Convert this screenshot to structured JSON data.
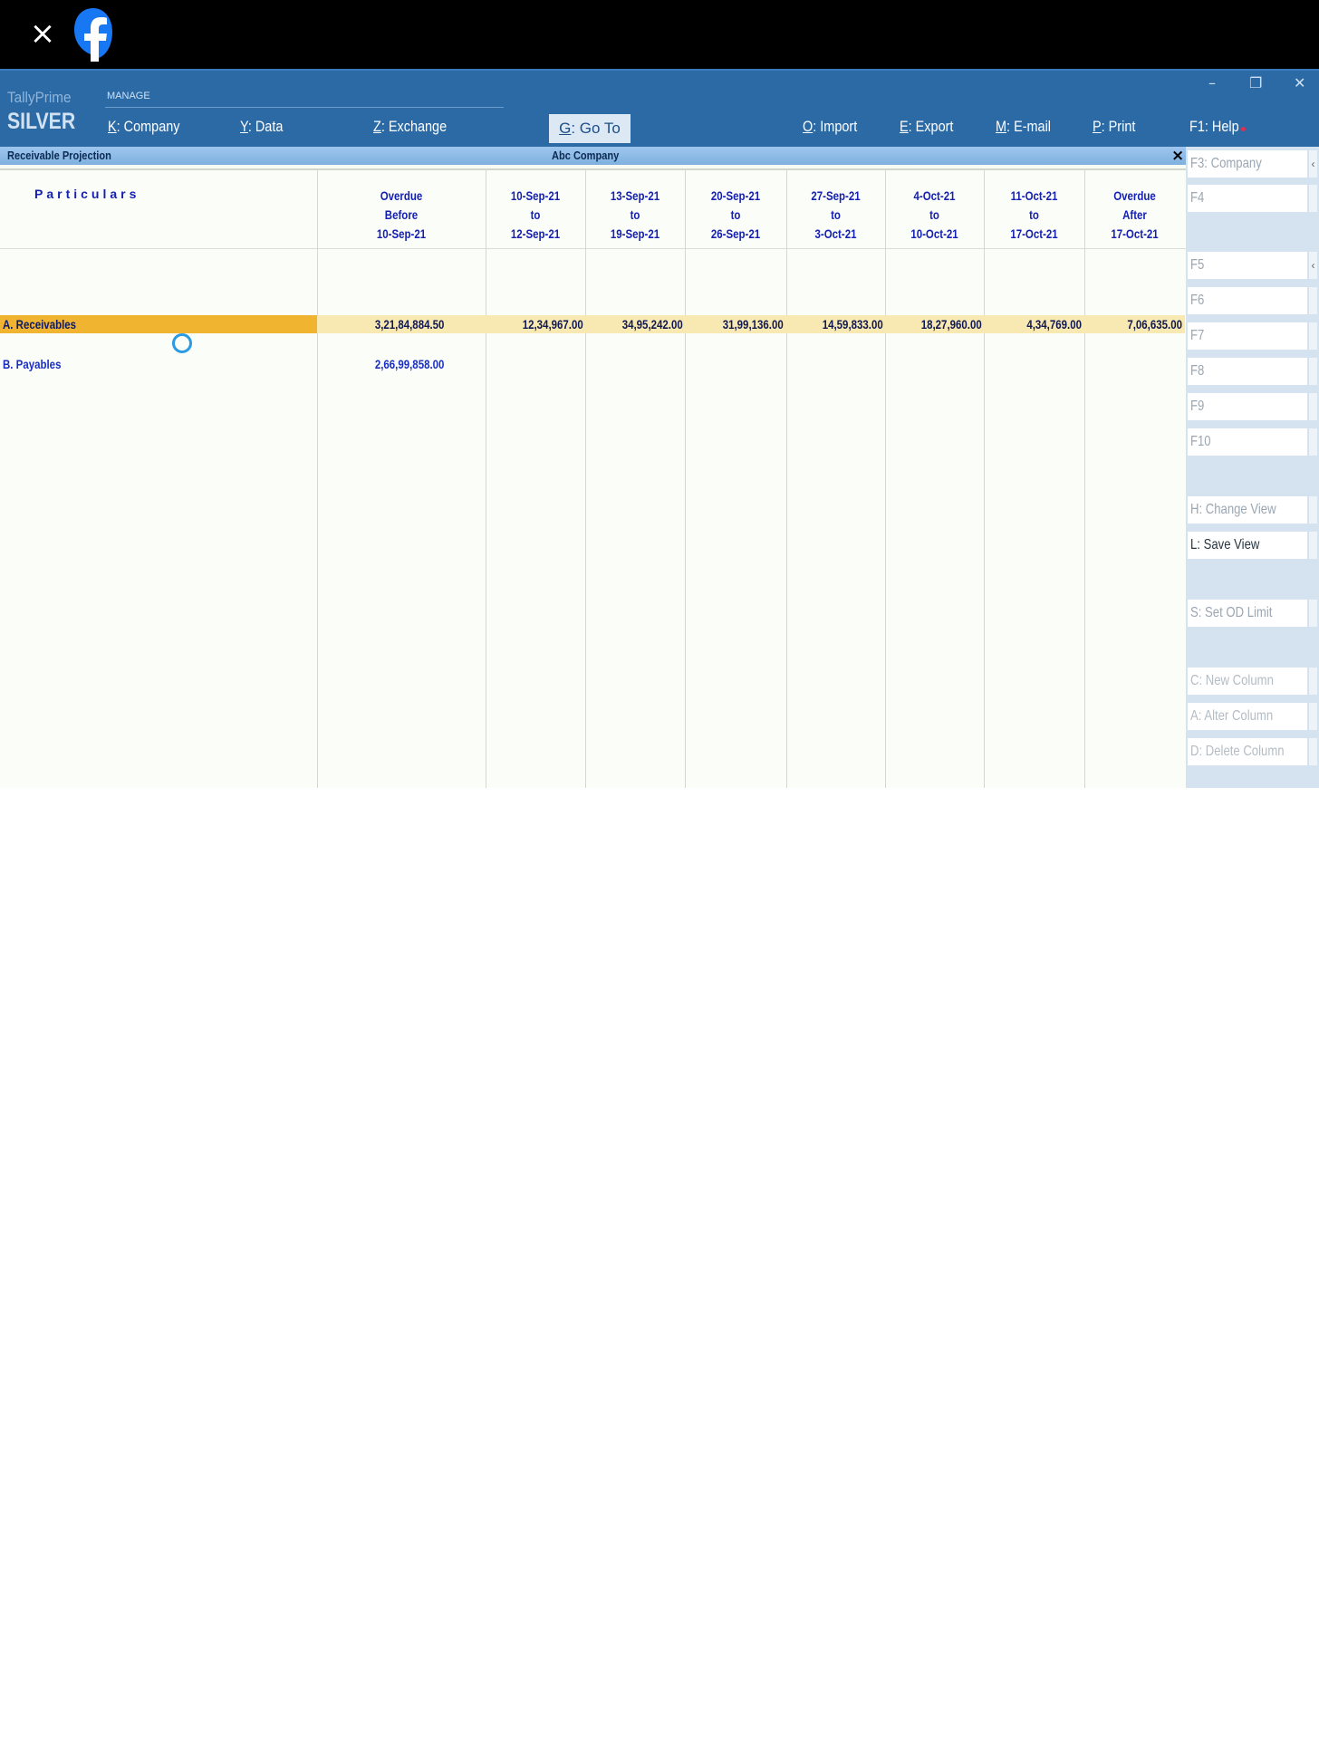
{
  "viewer": {
    "close_icon": "×"
  },
  "brand": {
    "top": "TallyPrime",
    "bottom": "SILVER"
  },
  "menu": {
    "section": "MANAGE",
    "company": {
      "key": "K",
      "label": ": Company"
    },
    "data": {
      "key": "Y",
      "label": ": Data"
    },
    "exchange": {
      "key": "Z",
      "label": ": Exchange"
    },
    "goto": {
      "key": "G",
      "label": ": Go To"
    },
    "import": {
      "key": "O",
      "label": ": Import"
    },
    "export": {
      "key": "E",
      "label": ": Export"
    },
    "email": {
      "key": "M",
      "label": ": E-mail"
    },
    "print": {
      "key": "P",
      "label": ": Print"
    },
    "help": {
      "key": "F1",
      "label": ": Help"
    }
  },
  "window_controls": {
    "minimize": "–",
    "restore": "❐",
    "close": "✕"
  },
  "report": {
    "title": "Receivable Projection",
    "company": "Abc Company",
    "close": "×",
    "particulars_header": "Particulars",
    "columns": [
      [
        "Overdue",
        "Before",
        "10-Sep-21"
      ],
      [
        "10-Sep-21",
        "to",
        "12-Sep-21"
      ],
      [
        "13-Sep-21",
        "to",
        "19-Sep-21"
      ],
      [
        "20-Sep-21",
        "to",
        "26-Sep-21"
      ],
      [
        "27-Sep-21",
        "to",
        "3-Oct-21"
      ],
      [
        "4-Oct-21",
        "to",
        "10-Oct-21"
      ],
      [
        "11-Oct-21",
        "to",
        "17-Oct-21"
      ],
      [
        "Overdue",
        "After",
        "17-Oct-21"
      ]
    ],
    "rows": [
      {
        "name": "A. Receivables",
        "values": [
          "3,21,84,884.50",
          "12,34,967.00",
          "34,95,242.00",
          "31,99,136.00",
          "14,59,833.00",
          "18,27,960.00",
          "4,34,769.00",
          "7,06,635.00"
        ]
      },
      {
        "name": "B. Payables",
        "values": [
          "2,66,99,858.00",
          "",
          "",
          "",
          "",
          "",
          "",
          ""
        ]
      }
    ]
  },
  "side_buttons": [
    {
      "label": "F3: Company"
    },
    {
      "label": "F4"
    },
    {
      "label": "F5"
    },
    {
      "label": "F6"
    },
    {
      "label": "F7"
    },
    {
      "label": "F8"
    },
    {
      "label": "F9"
    },
    {
      "label": "F10"
    },
    {
      "label": "H: Change View"
    },
    {
      "label": "L: Save View"
    },
    {
      "label": "S: Set OD Limit"
    },
    {
      "label": "C: New Column"
    },
    {
      "label": "A: Alter Column"
    },
    {
      "label": "D: Delete Column"
    }
  ],
  "colors": {
    "titlebar": "#2c6aa6",
    "highlight": "#f0b431",
    "header_text": "#1420b0"
  }
}
